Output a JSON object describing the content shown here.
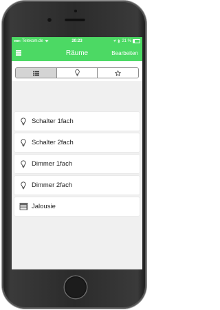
{
  "status_bar": {
    "carrier": "Telekom.de",
    "time": "20:23",
    "battery": "21 %"
  },
  "nav_bar": {
    "title": "Räume",
    "edit_label": "Bearbeiten",
    "menu_icon": "hamburger-menu-icon"
  },
  "segments": [
    {
      "icon": "list-icon",
      "selected": true
    },
    {
      "icon": "bulb-icon",
      "selected": false
    },
    {
      "icon": "star-icon",
      "selected": false
    }
  ],
  "devices": [
    {
      "label": "Schalter 1fach",
      "icon": "bulb-icon"
    },
    {
      "label": "Schalter 2fach",
      "icon": "bulb-icon"
    },
    {
      "label": "Dimmer 1fach",
      "icon": "bulb-icon"
    },
    {
      "label": "Dimmer 2fach",
      "icon": "bulb-icon"
    },
    {
      "label": "Jalousie",
      "icon": "blinds-icon"
    }
  ],
  "colors": {
    "accent": "#4cd964",
    "list_background": "#f0f0f0",
    "segment_selected": "#d4d4d4"
  }
}
